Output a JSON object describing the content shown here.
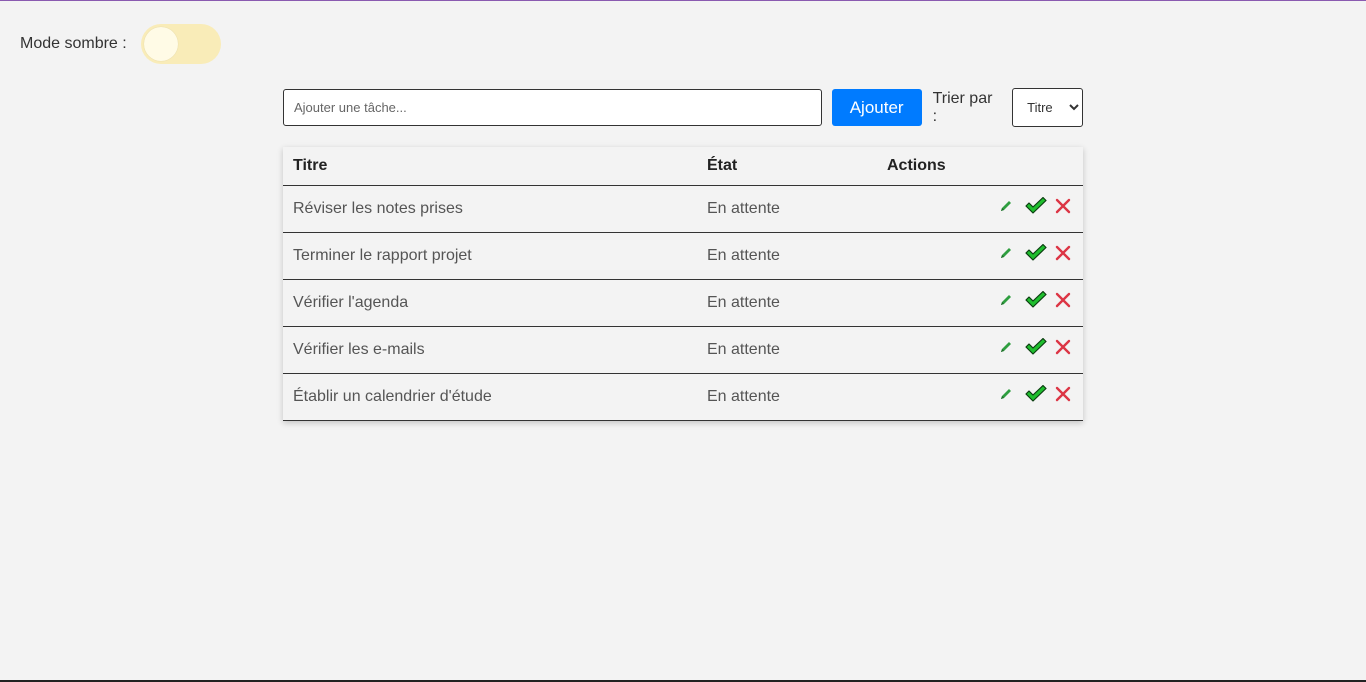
{
  "dark_mode": {
    "label": "Mode sombre :",
    "enabled": false,
    "track_color": "#f9ecb8"
  },
  "add_task": {
    "placeholder": "Ajouter une tâche...",
    "value": "",
    "button_label": "Ajouter",
    "button_color": "#007bff"
  },
  "sort": {
    "label": "Trier par :",
    "selected": "Titre"
  },
  "table": {
    "headers": {
      "title": "Titre",
      "state": "État",
      "actions": "Actions"
    },
    "rows": [
      {
        "title": "Réviser les notes prises",
        "state": "En attente"
      },
      {
        "title": "Terminer le rapport projet",
        "state": "En attente"
      },
      {
        "title": "Vérifier l'agenda",
        "state": "En attente"
      },
      {
        "title": "Vérifier les e-mails",
        "state": "En attente"
      },
      {
        "title": "Établir un calendrier d'étude",
        "state": "En attente"
      }
    ]
  },
  "colors": {
    "edit_icon": "#2e9e3f",
    "done_icon": "#1fbe2e",
    "delete_icon": "#dc3545"
  },
  "icons": {
    "edit": "pencil-icon",
    "done": "checkmark-icon",
    "delete": "close-icon"
  }
}
